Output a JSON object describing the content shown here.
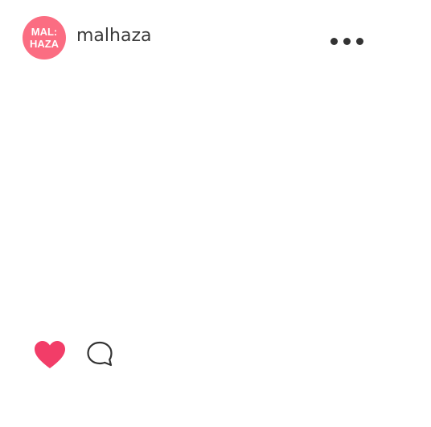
{
  "post": {
    "author": {
      "avatar_line1": "MAL:",
      "avatar_line2": "HAZA",
      "username": "malhaza"
    },
    "more_menu_icon": "ellipsis-icon",
    "actions": {
      "like_icon": "heart-filled-icon",
      "comment_icon": "speech-bubble-icon"
    }
  },
  "colors": {
    "avatar_bg": "#fb6d82",
    "like_active": "#f23d68",
    "text": "#3b3b3b",
    "icon_dark": "#333333"
  }
}
